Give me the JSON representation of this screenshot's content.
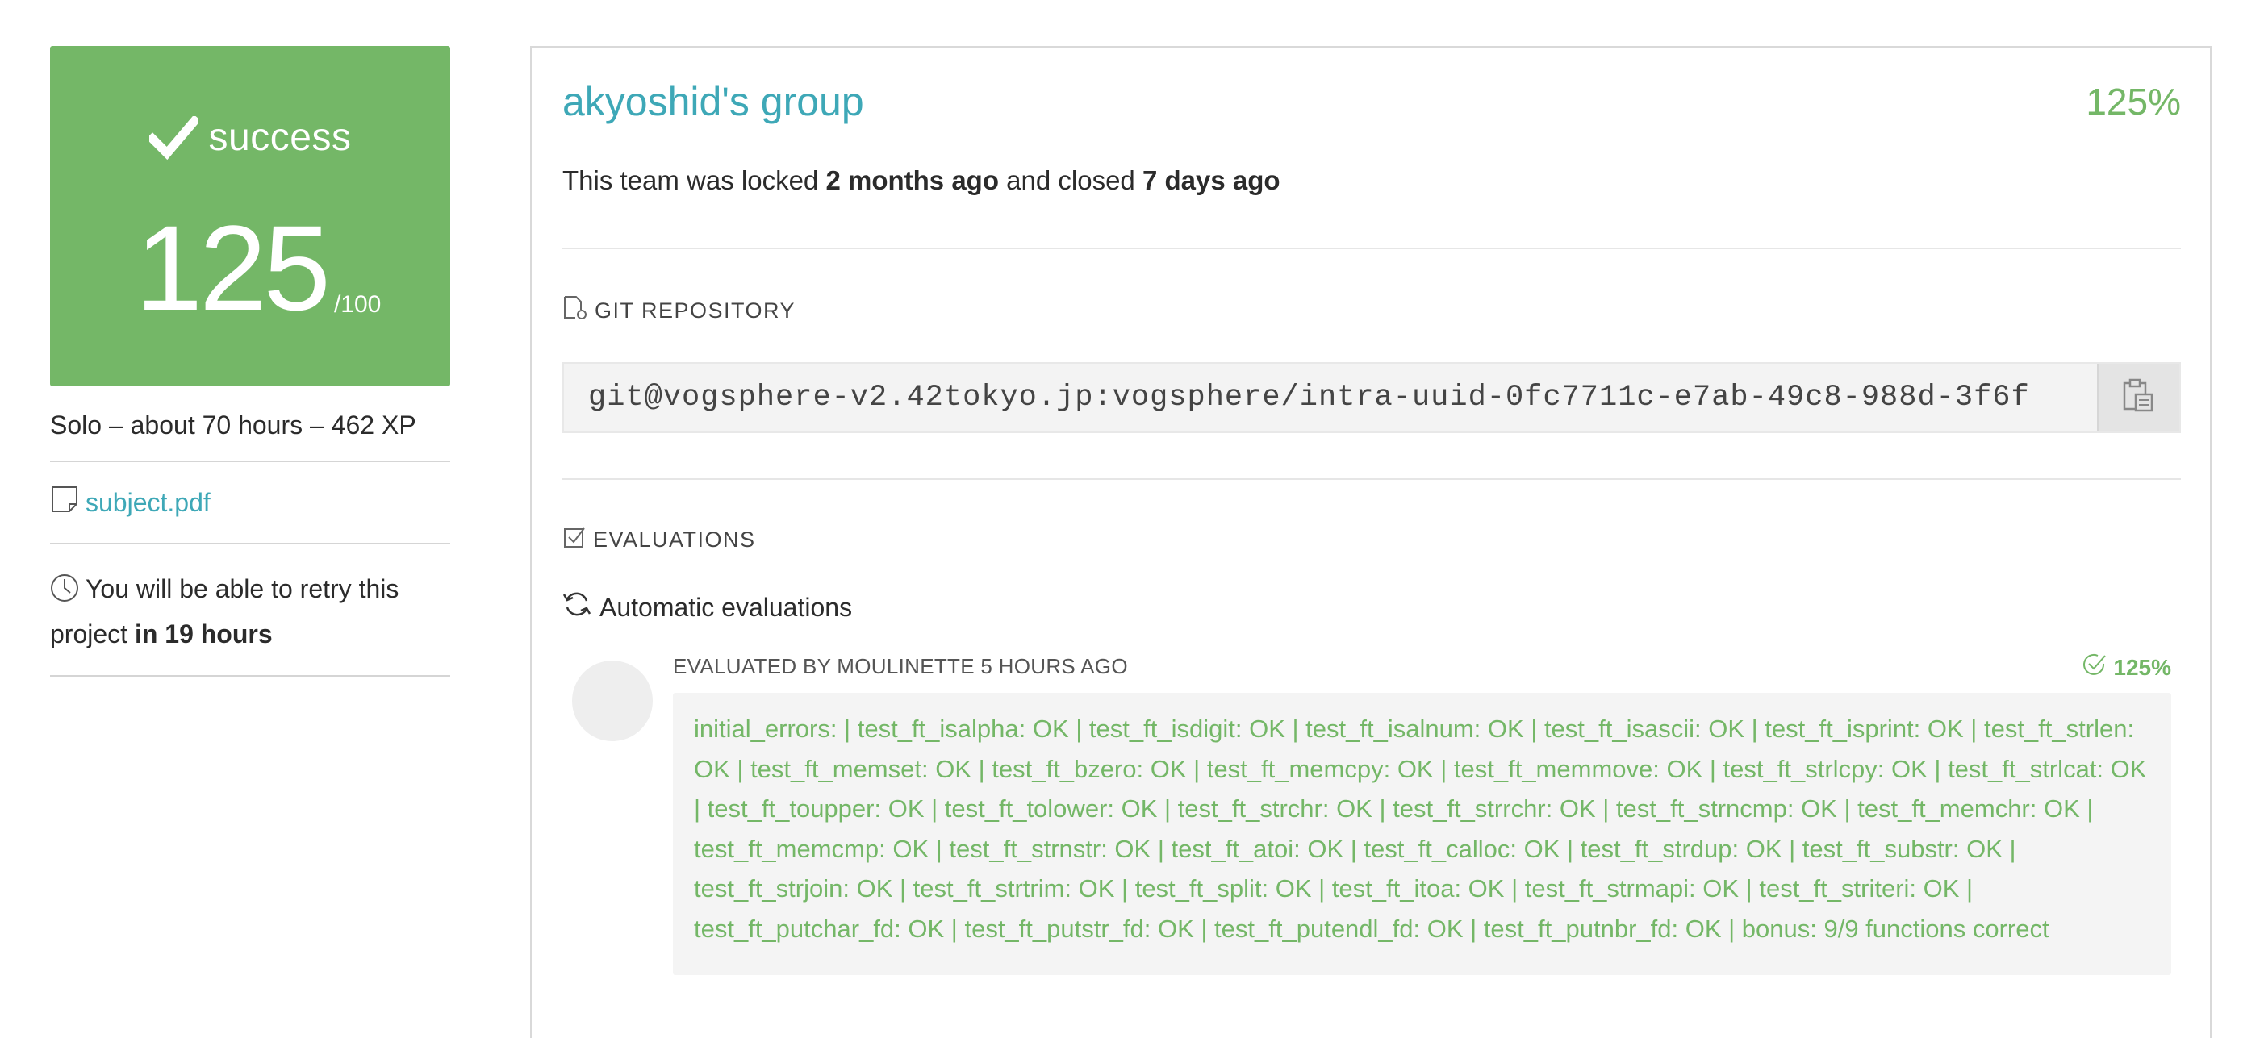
{
  "left": {
    "status": "success",
    "score": "125",
    "score_max": "/100",
    "meta": "Solo – about 70 hours – 462 XP",
    "subject_link": "subject.pdf",
    "retry_prefix": "You will be able to retry this project ",
    "retry_bold": "in 19 hours"
  },
  "group": {
    "title": "akyoshid's group",
    "percent": "125%",
    "lock_prefix": "This team was locked ",
    "lock_bold1": "2 months ago",
    "lock_middle": " and closed ",
    "lock_bold2": "7 days ago"
  },
  "git": {
    "heading": "GIT REPOSITORY",
    "url": "git@vogsphere-v2.42tokyo.jp:vogsphere/intra-uuid-0fc7711c-e7ab-49c8-988d-3f6f"
  },
  "evaluations": {
    "heading": "EVALUATIONS",
    "automatic_label": "Automatic evaluations",
    "evaluator": "EVALUATED BY MOULINETTE 5 HOURS AGO",
    "percent": "125%",
    "feedback": "initial_errors: | test_ft_isalpha: OK | test_ft_isdigit: OK | test_ft_isalnum: OK | test_ft_isascii: OK | test_ft_isprint: OK | test_ft_strlen: OK | test_ft_memset: OK | test_ft_bzero: OK | test_ft_memcpy: OK | test_ft_memmove: OK | test_ft_strlcpy: OK | test_ft_strlcat: OK | test_ft_toupper: OK | test_ft_tolower: OK | test_ft_strchr: OK | test_ft_strrchr: OK | test_ft_strncmp: OK | test_ft_memchr: OK | test_ft_memcmp: OK | test_ft_strnstr: OK | test_ft_atoi: OK | test_ft_calloc: OK | test_ft_strdup: OK | test_ft_substr: OK | test_ft_strjoin: OK | test_ft_strtrim: OK | test_ft_split: OK | test_ft_itoa: OK | test_ft_strmapi: OK | test_ft_striteri: OK | test_ft_putchar_fd: OK | test_ft_putstr_fd: OK | test_ft_putendl_fd: OK | test_ft_putnbr_fd: OK | bonus: 9/9 functions correct"
  },
  "colors": {
    "success_green": "#74b767",
    "link_teal": "#3ea8b7"
  },
  "icons": [
    "check-icon",
    "file-icon",
    "clock-icon",
    "git-icon",
    "clipboard-icon",
    "checkbox-icon",
    "refresh-icon",
    "check-circle-icon"
  ]
}
